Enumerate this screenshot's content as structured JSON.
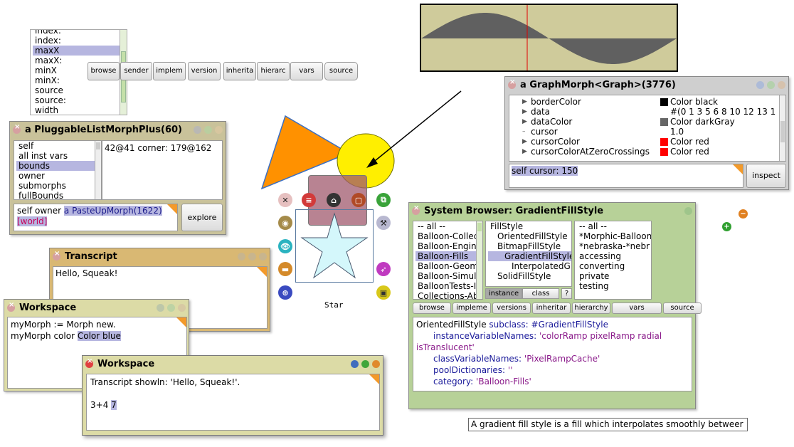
{
  "field_list": {
    "items": [
      "index:",
      "index:",
      "maxX",
      "maxX:",
      "minX",
      "minX:",
      "source",
      "source:",
      "width"
    ],
    "selected_index": 2
  },
  "floating_toolbar": [
    "browse",
    "sender",
    "implem",
    "version",
    "inherita",
    "hierarc",
    "vars",
    "source"
  ],
  "inspector": {
    "title": "a PluggableListMorphPlus(60)",
    "fields": [
      "self",
      "all inst vars",
      "bounds",
      "owner",
      "submorphs",
      "fullBounds"
    ],
    "selected_index": 2,
    "value_text": "42@41 corner: 179@162",
    "eval_prefix": "self owner",
    "eval_result": "a PasteUpMorph(1622)",
    "eval_world": "[world]",
    "explore_label": "explore"
  },
  "transcript": {
    "title": "Transcript",
    "text": "Hello, Squeak!"
  },
  "workspace1": {
    "title": "Workspace",
    "line1": "myMorph := Morph new.",
    "line2_prefix": "myMorph color",
    "line2_sel": "Color blue"
  },
  "workspace2": {
    "title": "Workspace",
    "line1": "Transcript showln: 'Hello, Squeak!'.",
    "line3_prefix": "3+4",
    "line3_result": "7"
  },
  "star_label": "Star",
  "graph_inspector": {
    "title": "a GraphMorph<Graph>(3776)",
    "rows": [
      {
        "name": "borderColor",
        "value": "Color black",
        "swatch": "#000000",
        "arrow": true
      },
      {
        "name": "data",
        "value": "#(0 1 3 5 6 8 10 12 13 1",
        "swatch": "",
        "arrow": true
      },
      {
        "name": "dataColor",
        "value": "Color darkGray",
        "swatch": "#666666",
        "arrow": true
      },
      {
        "name": "cursor",
        "value": "1.0",
        "swatch": "",
        "arrow": false
      },
      {
        "name": "cursorColor",
        "value": "Color red",
        "swatch": "#ff0000",
        "arrow": true
      },
      {
        "name": "cursorColorAtZeroCrossings",
        "value": "Color red",
        "swatch": "#ff0000",
        "arrow": true
      }
    ],
    "eval_text": "self cursor: 150",
    "inspect_label": "inspect"
  },
  "browser": {
    "title": "System Browser: GradientFillStyle",
    "categories": [
      "-- all --",
      "Balloon-Collec",
      "Balloon-Engine",
      "Balloon-Fills",
      "Balloon-Geom",
      "Balloon-Simula",
      "BalloonTests-I",
      "Collections-Ab"
    ],
    "categories_selected": 3,
    "classes": [
      {
        "name": "FillStyle",
        "indent": 0
      },
      {
        "name": "OrientedFillStyle",
        "indent": 1
      },
      {
        "name": "BitmapFillStyle",
        "indent": 1
      },
      {
        "name": "GradientFillStyle",
        "indent": 2
      },
      {
        "name": "InterpolatedGra",
        "indent": 3
      },
      {
        "name": "SolidFillStyle",
        "indent": 1
      }
    ],
    "classes_selected": 3,
    "protocols": [
      "-- all --",
      "*Morphic-Balloon",
      "*nebraska-*nebr",
      "accessing",
      "converting",
      "private",
      "testing"
    ],
    "instance_label": "instance",
    "class_label": "class",
    "help_label": "?",
    "buttons": [
      "browse",
      "impleme",
      "versions",
      "inheritar",
      "hierarchy",
      "vars",
      "source"
    ],
    "code_l1_a": "OrientedFillStyle",
    "code_l1_b": " subclass: ",
    "code_l1_c": "#GradientFillStyle",
    "code_l2_a": "instanceVariableNames: ",
    "code_l2_b": "'colorRamp pixelRamp radial",
    "code_l3": "isTranslucent'",
    "code_l4_a": "classVariableNames: ",
    "code_l4_b": "'PixelRampCache'",
    "code_l5_a": "poolDictionaries: ",
    "code_l5_b": "''",
    "code_l6_a": "category: ",
    "code_l6_b": "'Balloon-Fills'"
  },
  "balloon_text": "A gradient fill style is a fill which interpolates smoothly betweer",
  "colors": {
    "inspector_bg": "#c9c29a",
    "transcript_bg": "#d9b873",
    "workspace_bg": "#dcdba6",
    "graph_bg": "#cfcfcf",
    "browser_bg": "#b7d198",
    "graph_fill": "#cfcb9b",
    "graph_wave": "#606060"
  }
}
